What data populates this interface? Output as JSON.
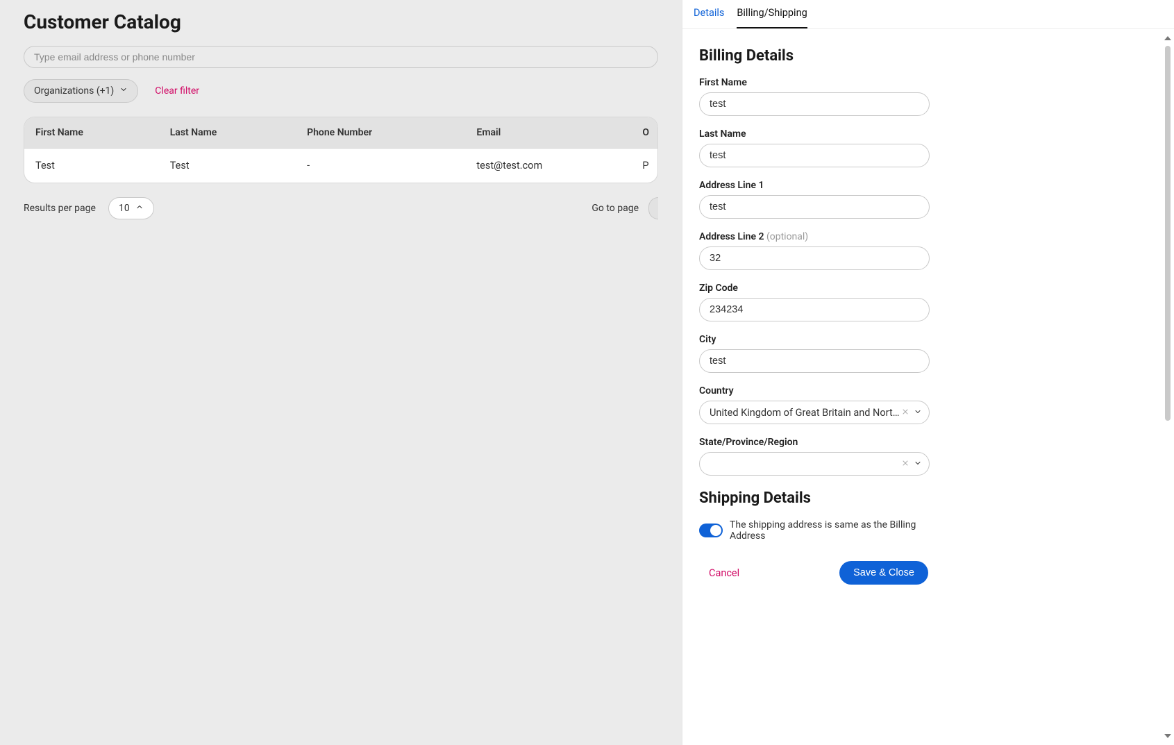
{
  "page": {
    "title": "Customer Catalog"
  },
  "search": {
    "placeholder": "Type email address or phone number"
  },
  "filters": {
    "orgs_label": "Organizations (+1)",
    "clear_label": "Clear filter"
  },
  "table": {
    "headers": {
      "first_name": "First Name",
      "last_name": "Last Name",
      "phone": "Phone Number",
      "email": "Email",
      "col5": "O"
    },
    "rows": [
      {
        "first_name": "Test",
        "last_name": "Test",
        "phone": "-",
        "email": "test@test.com",
        "col5": "P"
      }
    ]
  },
  "pager": {
    "results_label": "Results per page",
    "per_page_value": "10",
    "goto_label": "Go to page"
  },
  "panel": {
    "tabs": {
      "details": "Details",
      "billing_shipping": "Billing/Shipping"
    },
    "billing": {
      "title": "Billing Details",
      "first_name_label": "First Name",
      "first_name_value": "test",
      "last_name_label": "Last Name",
      "last_name_value": "test",
      "addr1_label": "Address Line 1",
      "addr1_value": "test",
      "addr2_label": "Address Line 2",
      "addr2_opt": "(optional)",
      "addr2_value": "32",
      "zip_label": "Zip Code",
      "zip_value": "234234",
      "city_label": "City",
      "city_value": "test",
      "country_label": "Country",
      "country_value": "United Kingdom of Great Britain and Northern Ir...",
      "state_label": "State/Province/Region",
      "state_value": ""
    },
    "shipping": {
      "title": "Shipping Details",
      "same_as_billing_label": "The shipping address is same as the Billing Address"
    },
    "actions": {
      "cancel": "Cancel",
      "save": "Save & Close"
    }
  }
}
